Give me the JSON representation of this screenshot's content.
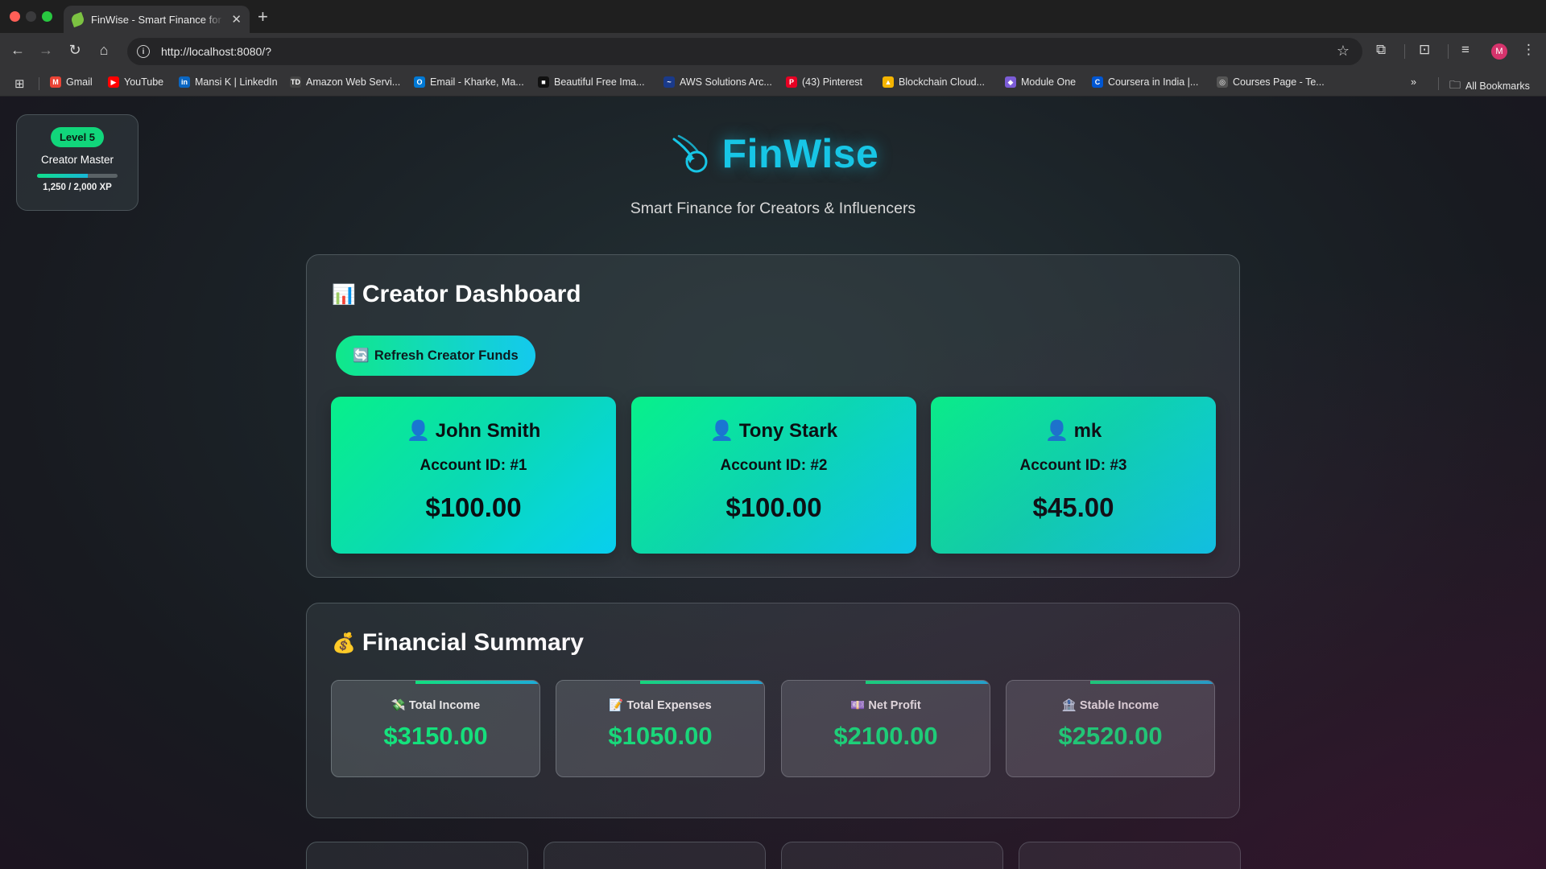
{
  "browser": {
    "tab_title": "FinWise - Smart Finance for Creators & Influencers",
    "url": "http://localhost:8080/?",
    "avatar_letter": "M",
    "bookmarks": [
      {
        "label": "Gmail",
        "icon": "gmail-icon",
        "color": "#ea4335",
        "glyph": "M"
      },
      {
        "label": "YouTube",
        "icon": "youtube-icon",
        "color": "#ff0000",
        "glyph": "▶"
      },
      {
        "label": "Mansi K | LinkedIn",
        "icon": "linkedin-icon",
        "color": "#0a66c2",
        "glyph": "in"
      },
      {
        "label": "Amazon Web Servi...",
        "icon": "aws-icon",
        "color": "#444444",
        "glyph": "TD"
      },
      {
        "label": "Email - Kharke, Ma...",
        "icon": "outlook-icon",
        "color": "#0078d4",
        "glyph": "O"
      },
      {
        "label": "Beautiful Free Ima...",
        "icon": "unsplash-icon",
        "color": "#111111",
        "glyph": "■"
      },
      {
        "label": "AWS Solutions Arc...",
        "icon": "aws-icon",
        "color": "#1a3a8a",
        "glyph": "~"
      },
      {
        "label": "(43) Pinterest",
        "icon": "pinterest-icon",
        "color": "#e60023",
        "glyph": "P"
      },
      {
        "label": "Blockchain Cloud...",
        "icon": "google-drive-icon",
        "color": "#f4b400",
        "glyph": "▲"
      },
      {
        "label": "Module One",
        "icon": "cube-icon",
        "color": "#7b5cd6",
        "glyph": "◆"
      },
      {
        "label": "Coursera in India |...",
        "icon": "coursera-icon",
        "color": "#0056d2",
        "glyph": "C"
      },
      {
        "label": "Courses Page - Te...",
        "icon": "globe-icon",
        "color": "#555555",
        "glyph": "◎"
      }
    ],
    "all_bookmarks_label": "All Bookmarks"
  },
  "xp": {
    "level": "Level 5",
    "title": "Creator Master",
    "progress_text": "1,250 / 2,000 XP",
    "progress_fraction": 0.625
  },
  "brand": {
    "name": "FinWise",
    "tagline": "Smart Finance for Creators & Influencers",
    "accent": "#17c6e6"
  },
  "dashboard": {
    "title": "Creator Dashboard",
    "emoji": "📊",
    "refresh_label": "Refresh Creator Funds",
    "refresh_emoji": "🔄",
    "accounts": [
      {
        "name": "John Smith",
        "account_id": "Account ID: #1",
        "balance": "$100.00"
      },
      {
        "name": "Tony Stark",
        "account_id": "Account ID: #2",
        "balance": "$100.00"
      },
      {
        "name": "mk",
        "account_id": "Account ID: #3",
        "balance": "$45.00"
      }
    ]
  },
  "summary": {
    "title": "Financial Summary",
    "emoji": "💰",
    "stats": [
      {
        "emoji": "💸",
        "label": "Total Income",
        "value": "$3150.00"
      },
      {
        "emoji": "📝",
        "label": "Total Expenses",
        "value": "$1050.00"
      },
      {
        "emoji": "💷",
        "label": "Net Profit",
        "value": "$2100.00"
      },
      {
        "emoji": "🏦",
        "label": "Stable Income",
        "value": "$2520.00"
      }
    ],
    "value_color": "#13e47d"
  }
}
